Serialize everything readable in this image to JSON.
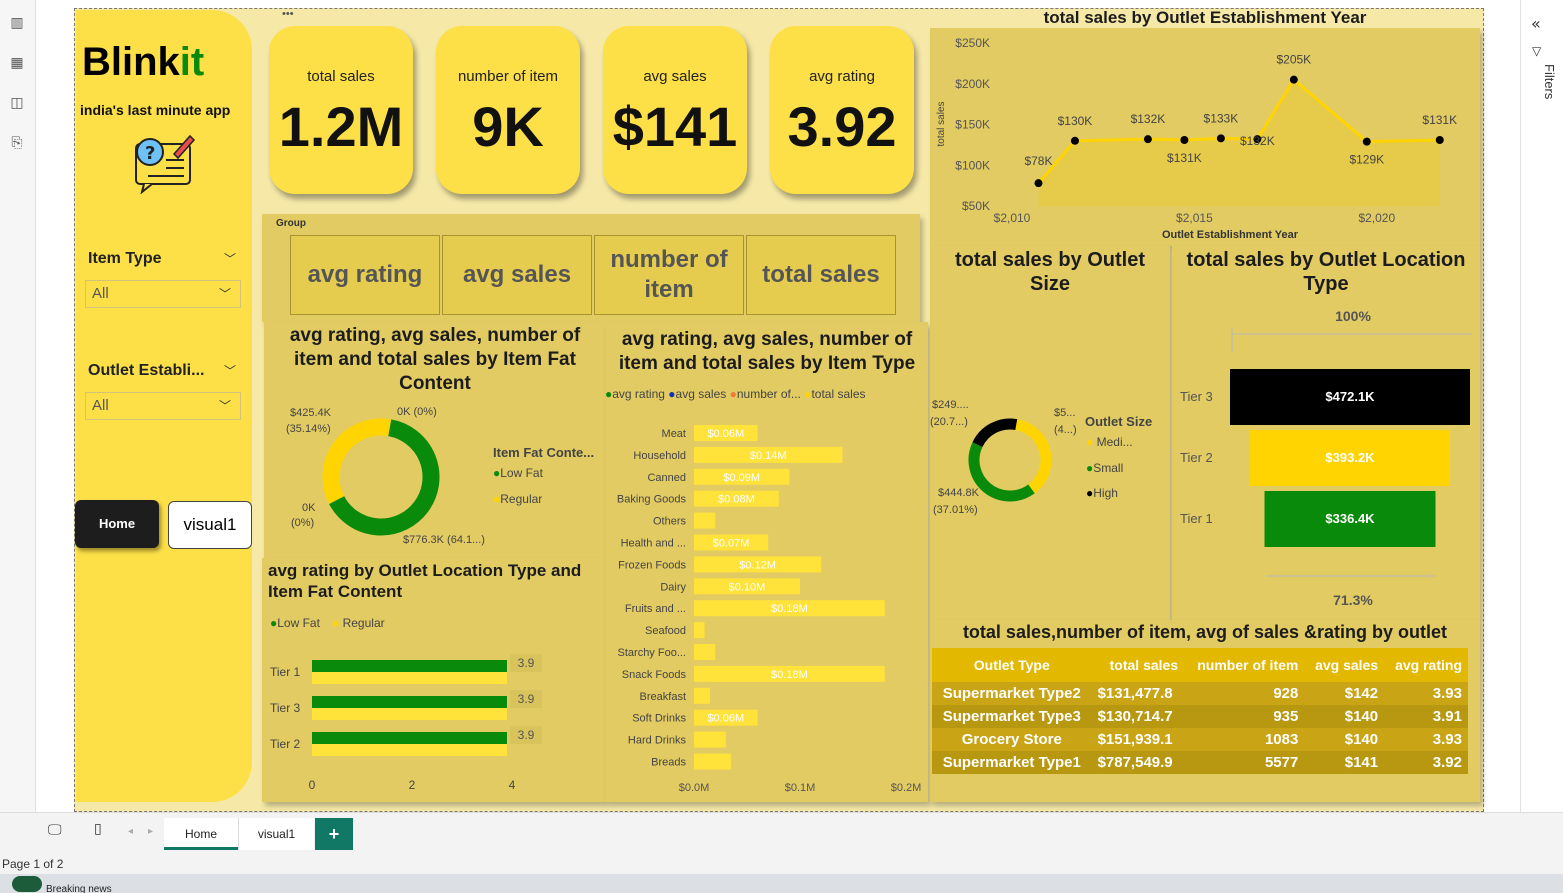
{
  "brand": {
    "name_main": "Blink",
    "name_accent": "it",
    "tagline": "india's last minute app"
  },
  "slicers": [
    {
      "title": "Item Type",
      "value": "All"
    },
    {
      "title": "Outlet Establi...",
      "value": "All"
    }
  ],
  "nav": {
    "home": "Home",
    "visual": "visual1"
  },
  "kpis": [
    {
      "label": "total sales",
      "value": "1.2M"
    },
    {
      "label": "number of item",
      "value": "9K"
    },
    {
      "label": "avg sales",
      "value": "$141"
    },
    {
      "label": "avg rating",
      "value": "3.92"
    }
  ],
  "group": {
    "label": "Group",
    "buttons": [
      "avg rating",
      "avg sales",
      "number of item",
      "total sales"
    ]
  },
  "fat_donut": {
    "title": "avg rating, avg sales, number of item and total sales by Item Fat Content",
    "legend_title": "Item Fat Conte...",
    "legend": [
      "Low Fat",
      "Regular"
    ],
    "labels": {
      "a": "$425.4K",
      "a2": "(35.14%)",
      "b": "0K (0%)",
      "c": "0K",
      "c2": "(0%)",
      "d": "$776.3K (64.1...)"
    }
  },
  "tier_fat": {
    "title": "avg rating by Outlet Location Type and Item Fat Content",
    "legend": [
      "Low Fat",
      "Regular"
    ],
    "ticks": [
      "0",
      "2",
      "4"
    ]
  },
  "item_type": {
    "title": "avg rating, avg sales, number of item and total sales by Item Type",
    "legend": [
      "avg rating",
      "avg sales",
      "number of...",
      "total sales"
    ],
    "ticks": [
      "$0.0M",
      "$0.1M",
      "$0.2M"
    ]
  },
  "year_line": {
    "title": "total sales by Outlet Establishment Year",
    "xlabel": "Outlet Establishment Year",
    "ylabel": "total sales",
    "yticks": [
      "$250K",
      "$200K",
      "$150K",
      "$100K",
      "$50K"
    ],
    "xticks": [
      "$2,010",
      "$2,015",
      "$2,020"
    ]
  },
  "size_donut": {
    "title": "total sales by Outlet Size",
    "legend_title": "Outlet Size",
    "legend": [
      "Medi...",
      "Small",
      "High"
    ],
    "labels": {
      "a": "$249....",
      "a2": "(20.7...)",
      "b": "$5...",
      "b2": "(4...)",
      "c": "$444.8K",
      "c2": "(37.01%)"
    }
  },
  "loc_funnel": {
    "title": "total sales by Outlet Location Type",
    "top_pct": "100%",
    "bottom_pct": "71.3%"
  },
  "outlet_table": {
    "title": "total sales,number of item, avg of sales &rating by outlet",
    "headers": [
      "Outlet Type",
      "total sales",
      "number of item",
      "avg sales",
      "avg rating"
    ],
    "rows": [
      [
        "Supermarket Type2",
        "$131,477.8",
        "928",
        "$142",
        "3.93"
      ],
      [
        "Supermarket Type3",
        "$130,714.7",
        "935",
        "$140",
        "3.91"
      ],
      [
        "Grocery Store",
        "$151,939.1",
        "1083",
        "$140",
        "3.93"
      ],
      [
        "Supermarket Type1",
        "$787,549.9",
        "5577",
        "$141",
        "3.92"
      ]
    ]
  },
  "tabs": [
    "Home",
    "visual1"
  ],
  "status": "Page 1 of 2",
  "taskbar_news": "Breaking news",
  "right_panel": "Filters",
  "colors": {
    "yellow": "#fde047",
    "green": "#0a8a0a",
    "black": "#000000",
    "gold": "#ffd400"
  },
  "chart_data": [
    {
      "type": "line",
      "title": "total sales by Outlet Establishment Year",
      "xlabel": "Outlet Establishment Year",
      "ylabel": "total sales",
      "x": [
        2011,
        2012,
        2014,
        2015,
        2016,
        2017,
        2018,
        2020,
        2022
      ],
      "values": [
        78000,
        130000,
        132000,
        131000,
        133000,
        132000,
        205000,
        129000,
        131000
      ],
      "data_labels": [
        "$78K",
        "$130K",
        "$132K",
        "$131K",
        "$133K",
        "$132K",
        "$205K",
        "$129K",
        "$131K"
      ],
      "ylim": [
        50000,
        250000
      ],
      "grid": false
    },
    {
      "type": "bar",
      "title": "avg rating, avg sales, number of item and total sales by Item Type",
      "categories": [
        "Meat",
        "Household",
        "Canned",
        "Baking Goods",
        "Others",
        "Health and ...",
        "Frozen Foods",
        "Dairy",
        "Fruits and ...",
        "Seafood",
        "Starchy Foo...",
        "Snack Foods",
        "Breakfast",
        "Soft Drinks",
        "Hard Drinks",
        "Breads"
      ],
      "values": [
        0.06,
        0.14,
        0.09,
        0.08,
        0.02,
        0.07,
        0.12,
        0.1,
        0.18,
        0.01,
        0.02,
        0.18,
        0.015,
        0.06,
        0.03,
        0.035
      ],
      "data_labels": [
        "$0.06M",
        "$0.14M",
        "$0.09M",
        "$0.08M",
        "",
        "$0.07M",
        "$0.12M",
        "$0.10M",
        "$0.18M",
        "",
        "",
        "$0.18M",
        "",
        "$0.06M",
        "",
        ""
      ],
      "xlim": [
        0,
        0.2
      ]
    },
    {
      "type": "bar",
      "title": "avg rating by Outlet Location Type and Item Fat Content",
      "categories": [
        "Tier 1",
        "Tier 3",
        "Tier 2"
      ],
      "series": [
        {
          "name": "Low Fat",
          "values": [
            3.9,
            3.9,
            3.9
          ]
        },
        {
          "name": "Regular",
          "values": [
            3.9,
            3.9,
            3.9
          ]
        }
      ],
      "data_labels": [
        "3.9",
        "3.9",
        "3.9"
      ],
      "xlim": [
        0,
        4
      ]
    },
    {
      "type": "pie",
      "title": "avg rating, avg sales, number of item and total sales by Item Fat Content",
      "categories": [
        "Low Fat",
        "Regular"
      ],
      "values": [
        776.3,
        425.4
      ]
    },
    {
      "type": "pie",
      "title": "total sales by Outlet Size",
      "categories": [
        "Medium",
        "Small",
        "High"
      ],
      "values": [
        444.8,
        249.0,
        507.0
      ]
    },
    {
      "type": "bar",
      "title": "total sales by Outlet Location Type",
      "categories": [
        "Tier 3",
        "Tier 2",
        "Tier 1"
      ],
      "values": [
        472.1,
        393.2,
        336.4
      ],
      "data_labels": [
        "$472.1K",
        "$393.2K",
        "$336.4K"
      ]
    }
  ]
}
